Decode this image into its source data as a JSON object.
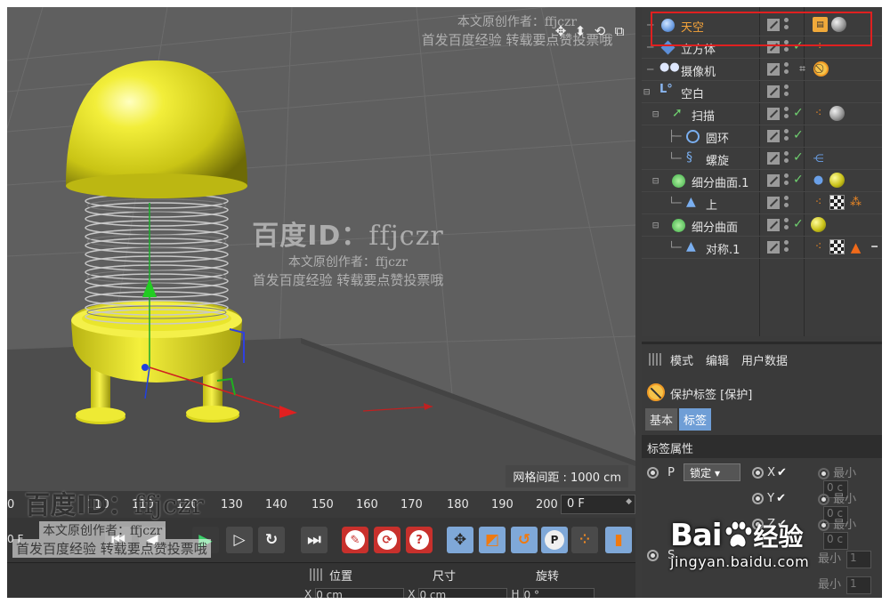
{
  "viewport": {
    "grid_spacing": "网格间距 : 1000 cm"
  },
  "timeline": {
    "ticks": [
      "0",
      "100",
      "110",
      "120",
      "130",
      "140",
      "150",
      "160",
      "170",
      "180",
      "190",
      "200"
    ],
    "current_frame": "0 F",
    "start_frame": "0 F"
  },
  "transport": {
    "icons": [
      "go-start-icon",
      "prev-key-icon",
      "play-icon",
      "next-frame-icon",
      "loop-icon",
      "go-end-icon",
      "record-icon",
      "autokey-icon",
      "keyframe-help-icon",
      "move-key-icon",
      "scale-key-icon",
      "rotate-key-icon",
      "param-key-icon",
      "point-level-icon",
      "film-icon"
    ]
  },
  "coords": {
    "position": "位置",
    "size": "尺寸",
    "rotation": "旋转",
    "x_pos": "X",
    "x_pos_value": "0 cm",
    "x_size": "X",
    "x_size_value": "0 cm",
    "h_rot": "H",
    "h_rot_value": "0 °"
  },
  "object_manager": {
    "objects": [
      {
        "name": "天空",
        "icon": "sky-icon",
        "level": 0,
        "highlighted": true
      },
      {
        "name": "立方体",
        "icon": "cube-icon",
        "level": 0
      },
      {
        "name": "摄像机",
        "icon": "camera-icon",
        "level": 0
      },
      {
        "name": "空白",
        "icon": "null-icon",
        "level": 0
      },
      {
        "name": "扫描",
        "icon": "sweep-icon",
        "level": 1
      },
      {
        "name": "圆环",
        "icon": "circle-spline-icon",
        "level": 2
      },
      {
        "name": "螺旋",
        "icon": "helix-spline-icon",
        "level": 2
      },
      {
        "name": "细分曲面.1",
        "icon": "subdivision-icon",
        "level": 1
      },
      {
        "name": "上",
        "icon": "polygon-object-icon",
        "level": 2
      },
      {
        "name": "细分曲面",
        "icon": "subdivision-icon",
        "level": 1
      },
      {
        "name": "对称.1",
        "icon": "symmetry-icon",
        "level": 2
      }
    ]
  },
  "attribute_manager": {
    "menu": [
      "模式",
      "编辑",
      "用户数据"
    ],
    "title": "保护标签 [保护]",
    "tabs": [
      "基本",
      "标签"
    ],
    "active_tab": "标签",
    "section": "标签属性",
    "p_label": "P",
    "p_mode": "锁定",
    "s_label": "S",
    "axes": [
      "X",
      "Y",
      "Z"
    ],
    "min_label": "最小",
    "min_value_placeholder": "0 c",
    "s_min_value": "1"
  },
  "watermarks": {
    "id_prefix": "百度ID：",
    "id_value": "ffjczr",
    "author_line": "本文原创作者：ffjczr",
    "repost_line": "首发百度经验  转载要点赞投票哦"
  },
  "brand": {
    "logo_text_left": "Bai",
    "logo_text_right": "经验",
    "url": "jingyan.baidu.com"
  },
  "colors": {
    "accent_blue": "#6f9ed6",
    "highlight_red": "#e02020",
    "sky_label": "#f5a33a",
    "model_yellow": "#e6e22a"
  }
}
